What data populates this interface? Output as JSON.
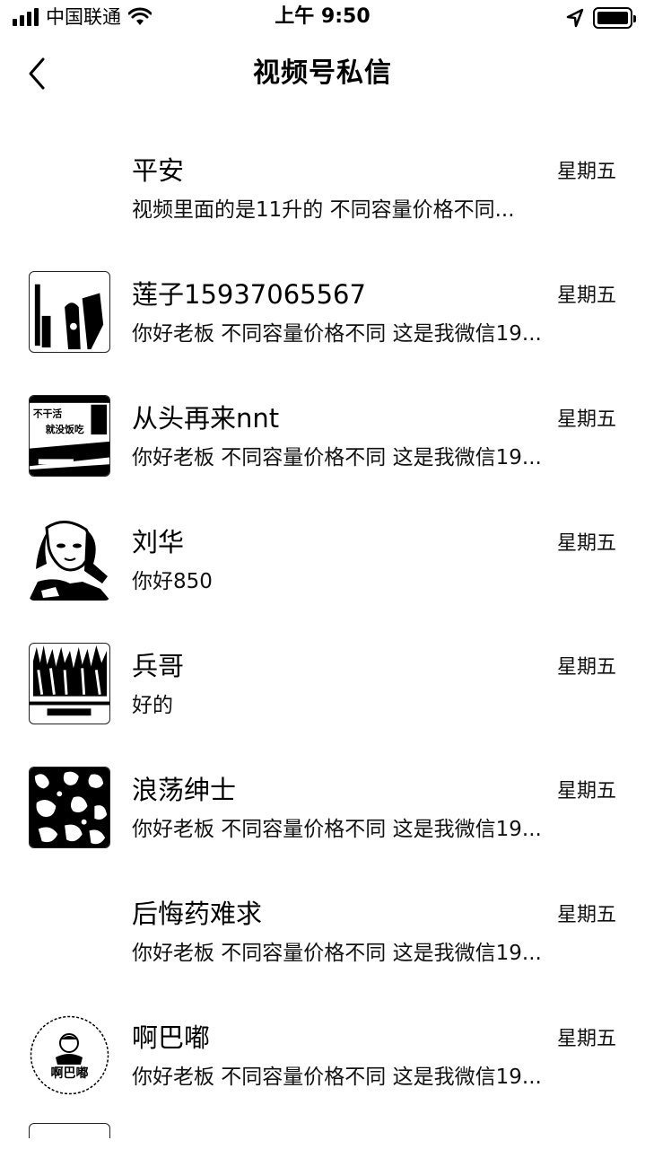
{
  "status_bar": {
    "carrier": "中国联通",
    "time": "上午 9:50"
  },
  "nav": {
    "title": "视频号私信"
  },
  "conversations": [
    {
      "name": "平安",
      "date": "星期五",
      "preview": "视频里面的是11升的  不同容量价格不同..."
    },
    {
      "name": "莲子15937065567",
      "date": "星期五",
      "preview": "你好老板 不同容量价格不同 这是我微信19..."
    },
    {
      "name": "从头再来nnt",
      "date": "星期五",
      "preview": "你好老板 不同容量价格不同 这是我微信19..."
    },
    {
      "name": "刘华",
      "date": "星期五",
      "preview": "你好850"
    },
    {
      "name": "兵哥",
      "date": "星期五",
      "preview": "好的"
    },
    {
      "name": "浪荡绅士",
      "date": "星期五",
      "preview": "你好老板 不同容量价格不同 这是我微信19..."
    },
    {
      "name": "后悔药难求",
      "date": "星期五",
      "preview": "你好老板 不同容量价格不同 这是我微信19..."
    },
    {
      "name": "啊巴嘟",
      "date": "星期五",
      "preview": "你好老板 不同容量价格不同 这是我微信19..."
    }
  ],
  "avatar_texts": {
    "row3_sign": "不干活 就没饭吃",
    "row8_logo": "啊巴嘟"
  }
}
